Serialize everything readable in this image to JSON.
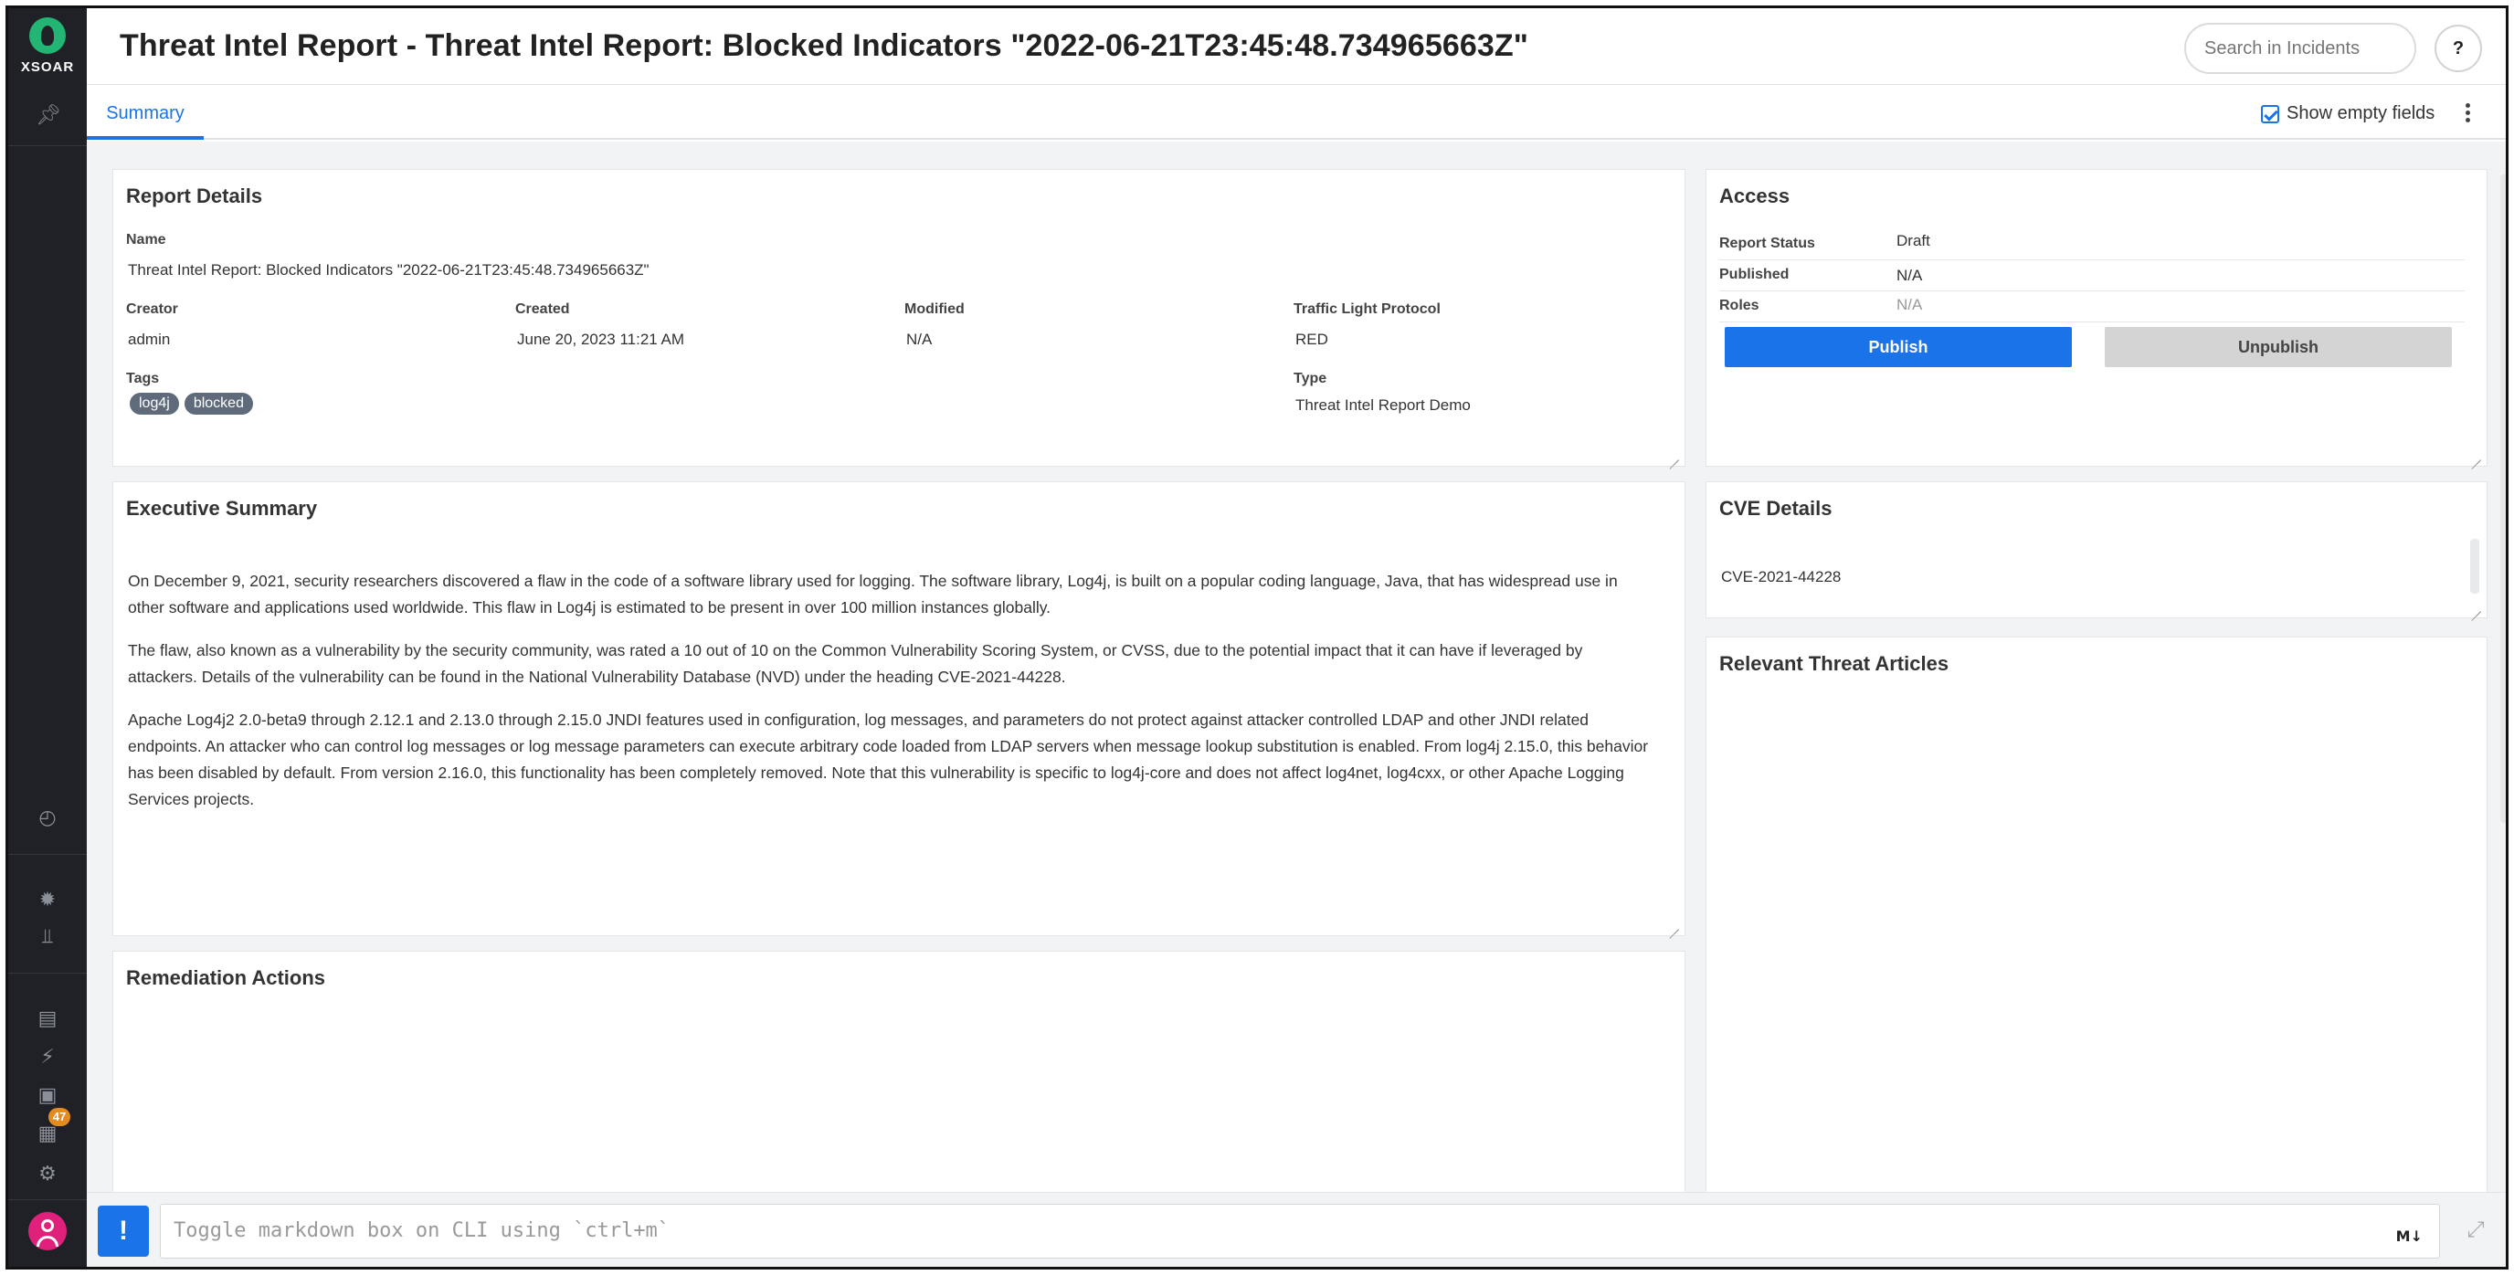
{
  "app": {
    "logo_text": "XSOAR",
    "title": "Threat Intel Report - Threat Intel Report: Blocked Indicators \"2022-06-21T23:45:48.734965663Z\""
  },
  "header": {
    "search_placeholder": "Search in Incidents",
    "help_label": "?"
  },
  "tabs": [
    {
      "label": "Summary",
      "active": true
    }
  ],
  "toolbar": {
    "show_empty_label": "Show empty fields",
    "show_empty_checked": true
  },
  "sidebar": {
    "badge_count": "47",
    "icons": [
      "pin-icon",
      "dashboard-icon",
      "bug-icon",
      "filter-icon",
      "book-icon",
      "bolt-icon",
      "briefcase-icon",
      "puzzle-icon",
      "gear-icon",
      "user-icon"
    ]
  },
  "report_details": {
    "title": "Report Details",
    "name_label": "Name",
    "name_value": "Threat Intel Report: Blocked Indicators \"2022-06-21T23:45:48.734965663Z\"",
    "creator_label": "Creator",
    "creator_value": "admin",
    "created_label": "Created",
    "created_value": "June 20, 2023 11:21 AM",
    "modified_label": "Modified",
    "modified_value": "N/A",
    "tlp_label": "Traffic Light Protocol",
    "tlp_value": "RED",
    "tags_label": "Tags",
    "tags": [
      "log4j",
      "blocked"
    ],
    "type_label": "Type",
    "type_value": "Threat Intel Report Demo"
  },
  "access": {
    "title": "Access",
    "status_label": "Report Status",
    "status_value": "Draft",
    "published_label": "Published",
    "published_value": "N/A",
    "roles_label": "Roles",
    "roles_value": "N/A",
    "publish_label": "Publish",
    "unpublish_label": "Unpublish"
  },
  "executive_summary": {
    "title": "Executive Summary",
    "paragraphs": [
      "On December 9, 2021, security researchers discovered a flaw in the code of a software library used for logging. The software library, Log4j, is built on a popular coding language, Java, that has widespread use in other software and applications used worldwide. This flaw in Log4j is estimated to be present in over 100 million instances globally.",
      "The flaw, also known as a vulnerability by the security community, was rated a 10 out of 10 on the Common Vulnerability Scoring System, or CVSS, due to the potential impact that it can have if leveraged by attackers. Details of the vulnerability can be found in the National Vulnerability Database (NVD) under the heading CVE-2021-44228.",
      "Apache Log4j2 2.0-beta9 through 2.12.1 and 2.13.0 through 2.15.0 JNDI features used in configuration, log messages, and parameters do not protect against attacker controlled LDAP and other JNDI related endpoints. An attacker who can control log messages or log message parameters can execute arbitrary code loaded from LDAP servers when message lookup substitution is enabled. From log4j 2.15.0, this behavior has been disabled by default. From version 2.16.0, this functionality has been completely removed. Note that this vulnerability is specific to log4j-core and does not affect log4net, log4cxx, or other Apache Logging Services projects."
    ]
  },
  "cve_details": {
    "title": "CVE Details",
    "value": "CVE-2021-44228"
  },
  "threat_articles": {
    "title": "Relevant Threat Articles"
  },
  "remediation": {
    "title": "Remediation Actions"
  },
  "cli": {
    "button_label": "!",
    "placeholder": "Toggle markdown box on CLI using `ctrl+m`",
    "markdown_label": "M↓"
  }
}
